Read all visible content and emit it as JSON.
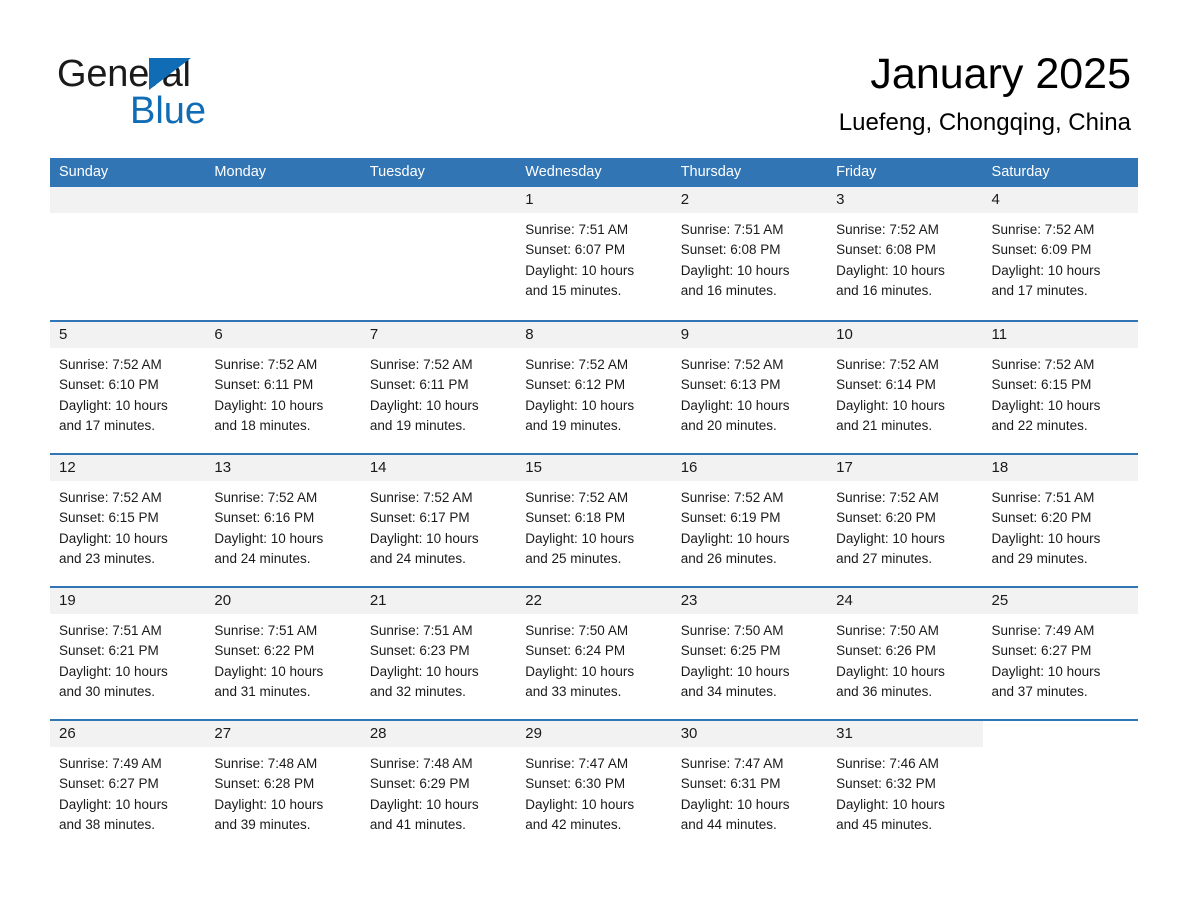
{
  "brand": {
    "word1": "General",
    "word2": "Blue",
    "flag_icon": "triangle-flag-icon",
    "accent_color": "#0f6cb5"
  },
  "header": {
    "month_title": "January 2025",
    "location": "Luefeng, Chongqing, China"
  },
  "calendar": {
    "header_bg": "#3175b4",
    "day_cell_bg": "#f2f2f2",
    "weekdays": [
      "Sunday",
      "Monday",
      "Tuesday",
      "Wednesday",
      "Thursday",
      "Friday",
      "Saturday"
    ],
    "weeks": [
      [
        {
          "day": "",
          "sunrise": "",
          "sunset": "",
          "daylight_line1": "",
          "daylight_line2": "",
          "empty": true
        },
        {
          "day": "",
          "sunrise": "",
          "sunset": "",
          "daylight_line1": "",
          "daylight_line2": "",
          "empty": true
        },
        {
          "day": "",
          "sunrise": "",
          "sunset": "",
          "daylight_line1": "",
          "daylight_line2": "",
          "empty": true
        },
        {
          "day": "1",
          "sunrise": "Sunrise: 7:51 AM",
          "sunset": "Sunset: 6:07 PM",
          "daylight_line1": "Daylight: 10 hours",
          "daylight_line2": "and 15 minutes."
        },
        {
          "day": "2",
          "sunrise": "Sunrise: 7:51 AM",
          "sunset": "Sunset: 6:08 PM",
          "daylight_line1": "Daylight: 10 hours",
          "daylight_line2": "and 16 minutes."
        },
        {
          "day": "3",
          "sunrise": "Sunrise: 7:52 AM",
          "sunset": "Sunset: 6:08 PM",
          "daylight_line1": "Daylight: 10 hours",
          "daylight_line2": "and 16 minutes."
        },
        {
          "day": "4",
          "sunrise": "Sunrise: 7:52 AM",
          "sunset": "Sunset: 6:09 PM",
          "daylight_line1": "Daylight: 10 hours",
          "daylight_line2": "and 17 minutes."
        }
      ],
      [
        {
          "day": "5",
          "sunrise": "Sunrise: 7:52 AM",
          "sunset": "Sunset: 6:10 PM",
          "daylight_line1": "Daylight: 10 hours",
          "daylight_line2": "and 17 minutes."
        },
        {
          "day": "6",
          "sunrise": "Sunrise: 7:52 AM",
          "sunset": "Sunset: 6:11 PM",
          "daylight_line1": "Daylight: 10 hours",
          "daylight_line2": "and 18 minutes."
        },
        {
          "day": "7",
          "sunrise": "Sunrise: 7:52 AM",
          "sunset": "Sunset: 6:11 PM",
          "daylight_line1": "Daylight: 10 hours",
          "daylight_line2": "and 19 minutes."
        },
        {
          "day": "8",
          "sunrise": "Sunrise: 7:52 AM",
          "sunset": "Sunset: 6:12 PM",
          "daylight_line1": "Daylight: 10 hours",
          "daylight_line2": "and 19 minutes."
        },
        {
          "day": "9",
          "sunrise": "Sunrise: 7:52 AM",
          "sunset": "Sunset: 6:13 PM",
          "daylight_line1": "Daylight: 10 hours",
          "daylight_line2": "and 20 minutes."
        },
        {
          "day": "10",
          "sunrise": "Sunrise: 7:52 AM",
          "sunset": "Sunset: 6:14 PM",
          "daylight_line1": "Daylight: 10 hours",
          "daylight_line2": "and 21 minutes."
        },
        {
          "day": "11",
          "sunrise": "Sunrise: 7:52 AM",
          "sunset": "Sunset: 6:15 PM",
          "daylight_line1": "Daylight: 10 hours",
          "daylight_line2": "and 22 minutes."
        }
      ],
      [
        {
          "day": "12",
          "sunrise": "Sunrise: 7:52 AM",
          "sunset": "Sunset: 6:15 PM",
          "daylight_line1": "Daylight: 10 hours",
          "daylight_line2": "and 23 minutes."
        },
        {
          "day": "13",
          "sunrise": "Sunrise: 7:52 AM",
          "sunset": "Sunset: 6:16 PM",
          "daylight_line1": "Daylight: 10 hours",
          "daylight_line2": "and 24 minutes."
        },
        {
          "day": "14",
          "sunrise": "Sunrise: 7:52 AM",
          "sunset": "Sunset: 6:17 PM",
          "daylight_line1": "Daylight: 10 hours",
          "daylight_line2": "and 24 minutes."
        },
        {
          "day": "15",
          "sunrise": "Sunrise: 7:52 AM",
          "sunset": "Sunset: 6:18 PM",
          "daylight_line1": "Daylight: 10 hours",
          "daylight_line2": "and 25 minutes."
        },
        {
          "day": "16",
          "sunrise": "Sunrise: 7:52 AM",
          "sunset": "Sunset: 6:19 PM",
          "daylight_line1": "Daylight: 10 hours",
          "daylight_line2": "and 26 minutes."
        },
        {
          "day": "17",
          "sunrise": "Sunrise: 7:52 AM",
          "sunset": "Sunset: 6:20 PM",
          "daylight_line1": "Daylight: 10 hours",
          "daylight_line2": "and 27 minutes."
        },
        {
          "day": "18",
          "sunrise": "Sunrise: 7:51 AM",
          "sunset": "Sunset: 6:20 PM",
          "daylight_line1": "Daylight: 10 hours",
          "daylight_line2": "and 29 minutes."
        }
      ],
      [
        {
          "day": "19",
          "sunrise": "Sunrise: 7:51 AM",
          "sunset": "Sunset: 6:21 PM",
          "daylight_line1": "Daylight: 10 hours",
          "daylight_line2": "and 30 minutes."
        },
        {
          "day": "20",
          "sunrise": "Sunrise: 7:51 AM",
          "sunset": "Sunset: 6:22 PM",
          "daylight_line1": "Daylight: 10 hours",
          "daylight_line2": "and 31 minutes."
        },
        {
          "day": "21",
          "sunrise": "Sunrise: 7:51 AM",
          "sunset": "Sunset: 6:23 PM",
          "daylight_line1": "Daylight: 10 hours",
          "daylight_line2": "and 32 minutes."
        },
        {
          "day": "22",
          "sunrise": "Sunrise: 7:50 AM",
          "sunset": "Sunset: 6:24 PM",
          "daylight_line1": "Daylight: 10 hours",
          "daylight_line2": "and 33 minutes."
        },
        {
          "day": "23",
          "sunrise": "Sunrise: 7:50 AM",
          "sunset": "Sunset: 6:25 PM",
          "daylight_line1": "Daylight: 10 hours",
          "daylight_line2": "and 34 minutes."
        },
        {
          "day": "24",
          "sunrise": "Sunrise: 7:50 AM",
          "sunset": "Sunset: 6:26 PM",
          "daylight_line1": "Daylight: 10 hours",
          "daylight_line2": "and 36 minutes."
        },
        {
          "day": "25",
          "sunrise": "Sunrise: 7:49 AM",
          "sunset": "Sunset: 6:27 PM",
          "daylight_line1": "Daylight: 10 hours",
          "daylight_line2": "and 37 minutes."
        }
      ],
      [
        {
          "day": "26",
          "sunrise": "Sunrise: 7:49 AM",
          "sunset": "Sunset: 6:27 PM",
          "daylight_line1": "Daylight: 10 hours",
          "daylight_line2": "and 38 minutes."
        },
        {
          "day": "27",
          "sunrise": "Sunrise: 7:48 AM",
          "sunset": "Sunset: 6:28 PM",
          "daylight_line1": "Daylight: 10 hours",
          "daylight_line2": "and 39 minutes."
        },
        {
          "day": "28",
          "sunrise": "Sunrise: 7:48 AM",
          "sunset": "Sunset: 6:29 PM",
          "daylight_line1": "Daylight: 10 hours",
          "daylight_line2": "and 41 minutes."
        },
        {
          "day": "29",
          "sunrise": "Sunrise: 7:47 AM",
          "sunset": "Sunset: 6:30 PM",
          "daylight_line1": "Daylight: 10 hours",
          "daylight_line2": "and 42 minutes."
        },
        {
          "day": "30",
          "sunrise": "Sunrise: 7:47 AM",
          "sunset": "Sunset: 6:31 PM",
          "daylight_line1": "Daylight: 10 hours",
          "daylight_line2": "and 44 minutes."
        },
        {
          "day": "31",
          "sunrise": "Sunrise: 7:46 AM",
          "sunset": "Sunset: 6:32 PM",
          "daylight_line1": "Daylight: 10 hours",
          "daylight_line2": "and 45 minutes."
        },
        {
          "day": "",
          "sunrise": "",
          "sunset": "",
          "daylight_line1": "",
          "daylight_line2": "",
          "empty": true,
          "blank": true
        }
      ]
    ]
  }
}
